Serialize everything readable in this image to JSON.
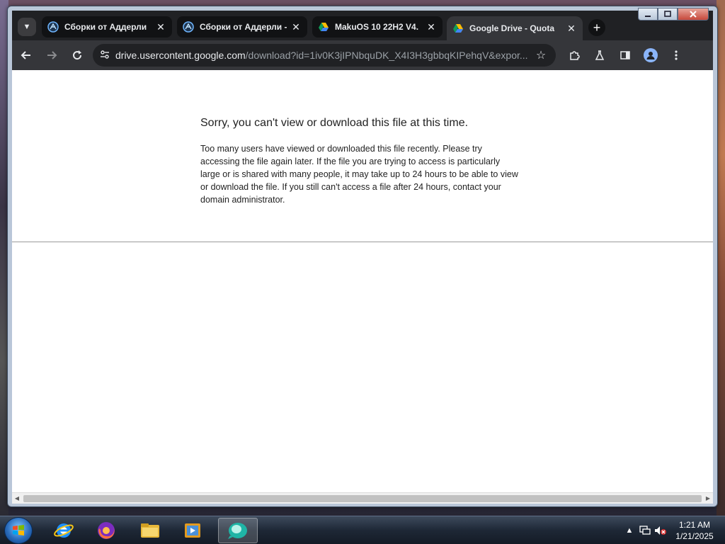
{
  "tabs": [
    {
      "title": "Сборки от Аддерли",
      "favicon": "adderly-site-icon",
      "active": false
    },
    {
      "title": "Сборки от Аддерли -",
      "favicon": "adderly-site-icon",
      "active": false
    },
    {
      "title": "MakuOS 10 22H2 V4.",
      "favicon": "google-drive-icon",
      "active": false
    },
    {
      "title": "Google Drive - Quota",
      "favicon": "google-drive-icon",
      "active": true
    }
  ],
  "tab_close_glyph": "✕",
  "new_tab_glyph": "+",
  "toolbar": {
    "url_host": "drive.usercontent.google.com",
    "url_path": "/download?id=1iv0K3jIPNbquDK_X4I3H3gbbqKIPehqV&expor..."
  },
  "page": {
    "heading": "Sorry, you can't view or download this file at this time.",
    "body": "Too many users have viewed or downloaded this file recently. Please try accessing the file again later. If the file you are trying to access is particularly large or is shared with many people, it may take up to 24 hours to be able to view or download the file. If you still can't access a file after 24 hours, contact your domain administrator."
  },
  "taskbar": {
    "apps": [
      "internet-explorer-icon",
      "firefox-icon",
      "file-explorer-icon",
      "media-player-icon",
      "browser-app-icon"
    ],
    "clock_time": "1:21 AM",
    "clock_date": "1/21/2025"
  },
  "colors": {
    "chrome_dark": "#202124",
    "toolbar": "#35363a",
    "accent_blue": "#8ab4f8"
  }
}
